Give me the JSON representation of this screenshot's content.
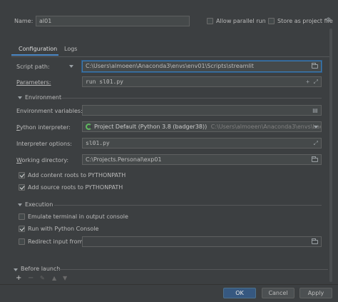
{
  "header": {
    "name_label": "Name:",
    "name_value": "al01",
    "allow_parallel_run": "Allow parallel run",
    "store_as_project_file": "Store as project file"
  },
  "tabs": [
    "Configuration",
    "Logs"
  ],
  "script": {
    "mode_label": "Script path:",
    "path": "C:\\Users\\almoeen\\Anaconda3\\envs\\env01\\Scripts\\streamlit"
  },
  "parameters": {
    "label": "Parameters:",
    "value": "run sl01.py"
  },
  "environment": {
    "section_title": "Environment",
    "env_vars_label": "Environment variables:",
    "env_vars_value": "",
    "interpreter_label": "Python interpreter:",
    "interpreter_value": "Project Default (Python 3.8 (badger38))",
    "interpreter_path": "C:\\Users\\almoeen\\Anaconda3\\envs\\badger38\\pytho",
    "interpreter_options_label": "Interpreter options:",
    "interpreter_options_value": "sl01.py",
    "working_dir_label": "Working directory:",
    "working_dir_value": "C:\\Projects.Personal\\exp01",
    "add_content_roots": "Add content roots to PYTHONPATH",
    "add_source_roots": "Add source roots to PYTHONPATH"
  },
  "execution": {
    "section_title": "Execution",
    "emulate_terminal": "Emulate terminal in output console",
    "run_with_console": "Run with Python Console",
    "redirect_input": "Redirect input from:",
    "redirect_value": ""
  },
  "before_launch": {
    "title": "Before launch"
  },
  "footer": {
    "ok": "OK",
    "cancel": "Cancel",
    "apply": "Apply"
  },
  "checkboxes": {
    "allow_parallel_run": false,
    "store_as_project_file": false,
    "add_content_roots": true,
    "add_source_roots": true,
    "emulate_terminal": false,
    "run_with_console": true,
    "redirect_input": false
  },
  "colors": {
    "background": "#3c3f41",
    "field": "#45494a",
    "accent": "#365880",
    "focus_border": "#3d7ab0"
  }
}
